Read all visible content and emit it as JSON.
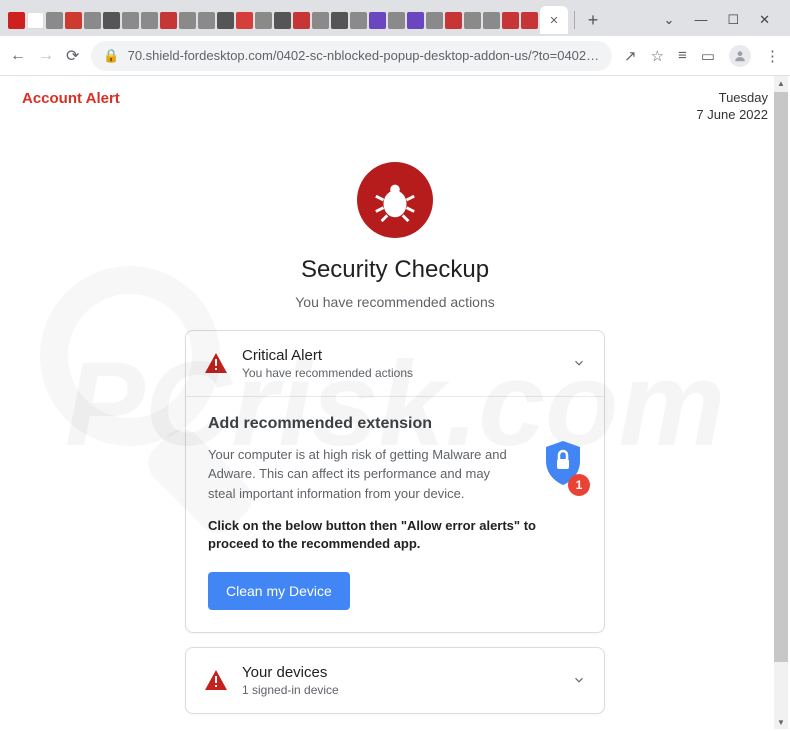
{
  "window": {
    "minimize": "—",
    "maximize": "☐",
    "close": "✕",
    "chevron": "⌄",
    "new_tab": "+"
  },
  "addressbar": {
    "url": "70.shield-fordesktop.com/0402-sc-nblocked-popup-desktop-addon-us/?to=0402-s…",
    "share": "↗",
    "star": "☆",
    "reader": "≡",
    "panel": "▭",
    "menu": "⋮"
  },
  "header": {
    "title": "Account Alert",
    "day": "Tuesday",
    "date": "7 June 2022"
  },
  "main": {
    "title": "Security Checkup",
    "subtitle": "You have recommended actions"
  },
  "card1": {
    "title": "Critical Alert",
    "subtitle": "You have recommended actions",
    "body_title": "Add recommended extension",
    "body_text": "Your computer is at high risk of getting Malware and Adware. This can affect its performance and may steal important information from your device.",
    "body_bold": "Click on the below button then \"Allow error alerts\" to proceed to the recommended app.",
    "button": "Clean my Device",
    "badge": "1"
  },
  "card2": {
    "title": "Your devices",
    "subtitle": "1 signed-in device"
  },
  "watermark": "PCrisk.com"
}
